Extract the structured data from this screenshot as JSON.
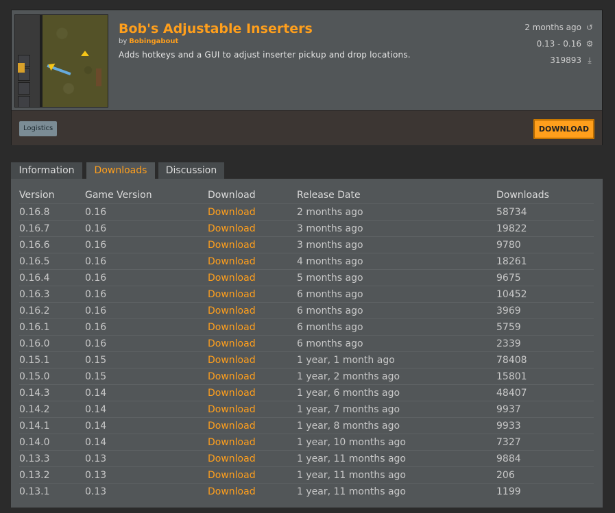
{
  "mod": {
    "title": "Bob's Adjustable Inserters",
    "by_label": "by",
    "author": "Bobingabout",
    "summary": "Adds hotkeys and a GUI to adjust inserter pickup and drop locations.",
    "updated": "2 months ago",
    "updated_icon": "history-icon",
    "game_versions": "0.13 - 0.16",
    "game_versions_icon": "gear-icon",
    "downloads": "319893",
    "downloads_icon": "download-icon",
    "tag": "Logistics",
    "download_button": "DOWNLOAD"
  },
  "tabs": [
    {
      "label": "Information",
      "active": false
    },
    {
      "label": "Downloads",
      "active": true
    },
    {
      "label": "Discussion",
      "active": false
    }
  ],
  "table": {
    "headers": [
      "Version",
      "Game Version",
      "Download",
      "Release Date",
      "Downloads"
    ],
    "rows": [
      [
        "0.16.8",
        "0.16",
        "Download",
        "2 months ago",
        "58734"
      ],
      [
        "0.16.7",
        "0.16",
        "Download",
        "3 months ago",
        "19822"
      ],
      [
        "0.16.6",
        "0.16",
        "Download",
        "3 months ago",
        "9780"
      ],
      [
        "0.16.5",
        "0.16",
        "Download",
        "4 months ago",
        "18261"
      ],
      [
        "0.16.4",
        "0.16",
        "Download",
        "5 months ago",
        "9675"
      ],
      [
        "0.16.3",
        "0.16",
        "Download",
        "6 months ago",
        "10452"
      ],
      [
        "0.16.2",
        "0.16",
        "Download",
        "6 months ago",
        "3969"
      ],
      [
        "0.16.1",
        "0.16",
        "Download",
        "6 months ago",
        "5759"
      ],
      [
        "0.16.0",
        "0.16",
        "Download",
        "6 months ago",
        "2339"
      ],
      [
        "0.15.1",
        "0.15",
        "Download",
        "1 year, 1 month ago",
        "78408"
      ],
      [
        "0.15.0",
        "0.15",
        "Download",
        "1 year, 2 months ago",
        "15801"
      ],
      [
        "0.14.3",
        "0.14",
        "Download",
        "1 year, 6 months ago",
        "48407"
      ],
      [
        "0.14.2",
        "0.14",
        "Download",
        "1 year, 7 months ago",
        "9937"
      ],
      [
        "0.14.1",
        "0.14",
        "Download",
        "1 year, 8 months ago",
        "9933"
      ],
      [
        "0.14.0",
        "0.14",
        "Download",
        "1 year, 10 months ago",
        "7327"
      ],
      [
        "0.13.3",
        "0.13",
        "Download",
        "1 year, 11 months ago",
        "9884"
      ],
      [
        "0.13.2",
        "0.13",
        "Download",
        "1 year, 11 months ago",
        "206"
      ],
      [
        "0.13.1",
        "0.13",
        "Download",
        "1 year, 11 months ago",
        "1199"
      ]
    ]
  },
  "colors": {
    "accent": "#ff9f1c",
    "page_bg": "#2b2b2b",
    "panel_bg": "#525658",
    "tag_bg": "#7b8c95"
  }
}
